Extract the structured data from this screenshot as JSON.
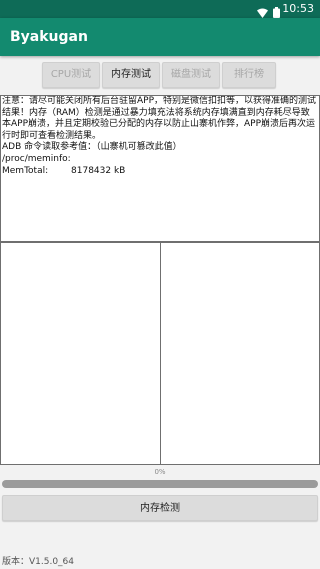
{
  "status_bar": {
    "time": "10:53",
    "wifi_icon": "wifi-icon",
    "battery_icon": "battery-icon"
  },
  "app": {
    "title": "Byakugan"
  },
  "tabs": [
    {
      "label": "CPU测试",
      "active": false
    },
    {
      "label": "内存测试",
      "active": true
    },
    {
      "label": "磁盘测试",
      "active": false
    },
    {
      "label": "排行榜",
      "active": false
    }
  ],
  "info": {
    "notice": "注意：请尽可能关闭所有后台驻留APP，特别是微信扣扣等，以获得准确的测试结果！内存（RAM）检测是通过暴力填充法将系统内存填满直到内存耗尽导致本APP崩溃，并且定期校验已分配的内存以防止山寨机作弊，APP崩溃后再次运行时即可查看检测结果。",
    "adb_line": "ADB 命令读取参考值：（山寨机可篡改此值）",
    "path": "/proc/meminfo:",
    "mem_label": "MemTotal:",
    "mem_value": "8178432 kB"
  },
  "progress": {
    "label": "0%",
    "value_fraction": 0.0
  },
  "actions": {
    "test_button": "内存检测"
  },
  "footer": {
    "version": "版本：V1.5.0_64"
  },
  "colors": {
    "primary": "#138a6f",
    "status_bar": "#0e6b57",
    "background": "#f2f2f2"
  }
}
